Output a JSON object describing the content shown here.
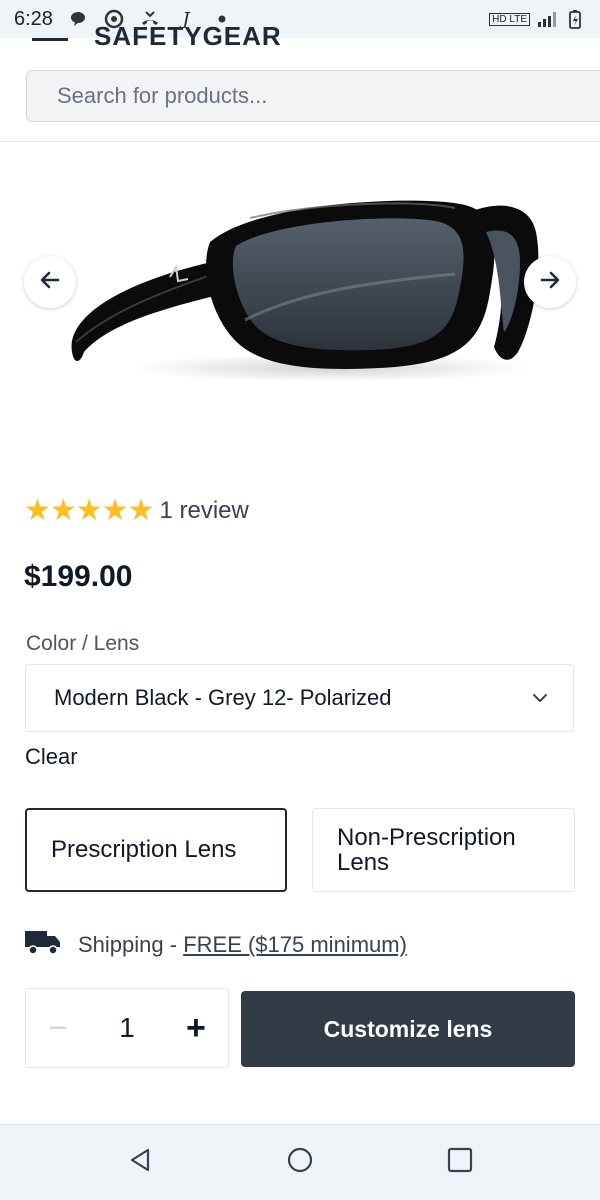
{
  "status_bar": {
    "time": "6:28",
    "indicators": [
      "chat-bubble-icon",
      "chrome-icon",
      "missed-call-icon",
      "j-icon",
      "dot-icon"
    ],
    "network_label": "HD LTE"
  },
  "header": {
    "logo_partial": "SAFETYGEAR",
    "search_placeholder": "Search for products..."
  },
  "gallery": {
    "prev_icon": "arrow-left-icon",
    "next_icon": "arrow-right-icon",
    "image_subject": "black sunglasses"
  },
  "product": {
    "rating_stars": 5,
    "stars_text": "★★★★★",
    "review_count_text": "1 review",
    "price": "$199.00"
  },
  "options": {
    "color_label": "Color / Lens",
    "color_selected": "Modern Black - Grey 12- Polarized",
    "clear_label": "Clear",
    "lens_prescription": "Prescription Lens",
    "lens_non_prescription": "Non-Prescription Lens"
  },
  "shipping": {
    "label": "Shipping - ",
    "free_text": "FREE ($175 minimum)"
  },
  "cart": {
    "quantity": "1",
    "minus": "−",
    "plus": "+",
    "customize_label": "Customize lens"
  },
  "colors": {
    "star": "#fbbf24",
    "primary_button": "#323c47",
    "status_bar_bg": "#eef4f8"
  }
}
